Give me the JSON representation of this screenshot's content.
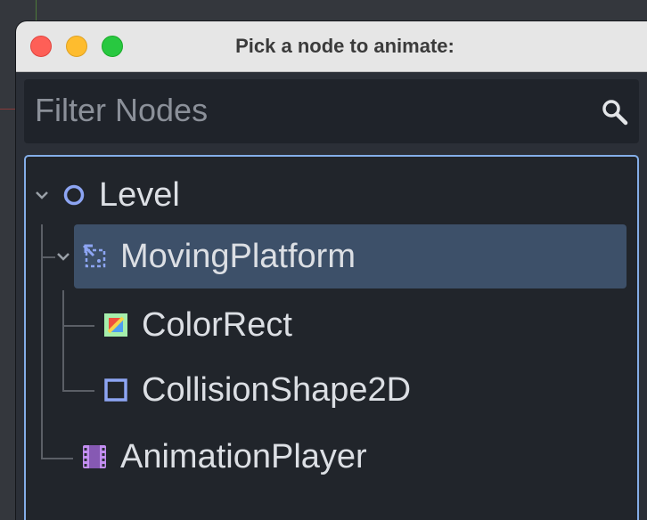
{
  "window": {
    "title": "Pick a node to animate:"
  },
  "filter": {
    "placeholder": "Filter Nodes",
    "icon": "search-icon"
  },
  "tree": {
    "nodes": [
      {
        "label": "Level",
        "icon": "node-circle-icon",
        "expanded": true
      },
      {
        "label": "MovingPlatform",
        "icon": "animatable-body-icon",
        "expanded": true,
        "selected": true
      },
      {
        "label": "ColorRect",
        "icon": "color-rect-icon"
      },
      {
        "label": "CollisionShape2D",
        "icon": "collision-shape-icon"
      },
      {
        "label": "AnimationPlayer",
        "icon": "animation-player-icon"
      }
    ]
  },
  "colors": {
    "selection": "#3d5069",
    "focus_border": "#84aee8",
    "node_icon": "#8da5f3",
    "animation_icon": "#c38ef1"
  }
}
